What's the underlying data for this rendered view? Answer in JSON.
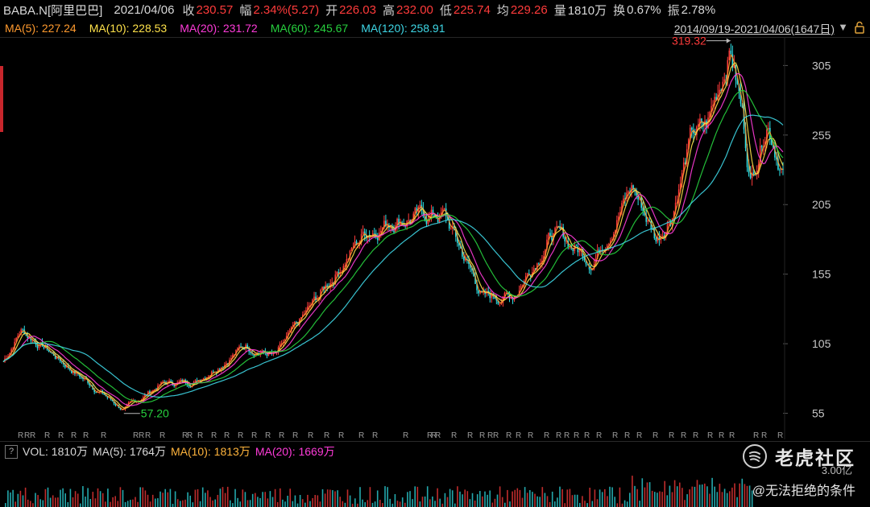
{
  "header": {
    "symbol": "BABA.N[阿里巴巴]",
    "date": "2021/04/06",
    "close_label": "收",
    "close": "230.57",
    "change_label": "幅",
    "change": "2.34%(5.27)",
    "open_label": "开",
    "open": "226.03",
    "high_label": "高",
    "high": "232.00",
    "low_label": "低",
    "low": "225.74",
    "avg_label": "均",
    "avg": "229.26",
    "vol_label": "量",
    "vol": "1810万",
    "turnover_label": "换",
    "turnover": "0.67%",
    "amplitude_label": "振",
    "amplitude": "2.78%"
  },
  "ma_bar": [
    {
      "text": "MA(5): 227.24",
      "color": "#ff9a2e"
    },
    {
      "text": "MA(10): 228.53",
      "color": "#ffe24a"
    },
    {
      "text": "MA(20): 231.72",
      "color": "#ff3bd9"
    },
    {
      "text": "MA(60): 245.67",
      "color": "#27d13e"
    },
    {
      "text": "MA(120): 258.91",
      "color": "#3ed7e6"
    }
  ],
  "range_text": "2014/09/19-2021/04/06(1647日)",
  "vol_bar": {
    "help": "?",
    "items": [
      {
        "text": "VOL: 1810万",
        "color": "#d8d8d8"
      },
      {
        "text": "MA(5): 1764万",
        "color": "#d8d8d8"
      },
      {
        "text": "MA(10): 1813万",
        "color": "#ffb43c"
      },
      {
        "text": "MA(20): 1669万",
        "color": "#ff3bd9"
      }
    ],
    "cap": "3.00亿"
  },
  "watermark": {
    "name": "老虎社区",
    "author": "@无法拒绝的条件"
  },
  "chart_data": {
    "type": "line",
    "description_series": "approximate daily close of BABA, Sep 2014 - Apr 2021",
    "x_range": [
      "2014/09/19",
      "2021/04/06"
    ],
    "ylim": [
      42,
      322
    ],
    "y_ticks": [
      55,
      105,
      155,
      205,
      255,
      305
    ],
    "annotations": [
      {
        "text": "319.32",
        "x": "2020/10/27",
        "y": 319.32,
        "color": "#ff3b3b"
      },
      {
        "text": "57.20",
        "x": "2015/09/24",
        "y": 57.2,
        "color": "#27d13e"
      }
    ],
    "r_marker": "R",
    "series": [
      {
        "x": [
          "2014/09/19",
          "2014/11/12",
          "2015/01/15",
          "2015/05/01",
          "2015/09/24",
          "2016/01/15",
          "2016/05/01",
          "2016/10/01",
          "2017/01/01",
          "2017/06/01",
          "2017/10/01",
          "2018/01/01",
          "2018/06/01",
          "2018/10/01",
          "2019/01/01",
          "2019/05/01",
          "2019/09/01",
          "2020/01/01",
          "2020/03/15",
          "2020/05/01",
          "2020/07/01",
          "2020/08/15",
          "2020/10/27",
          "2020/12/01",
          "2020/12/28",
          "2021/02/16",
          "2021/04/06"
        ],
        "values": [
          92,
          115,
          104,
          84,
          57.2,
          76,
          78,
          104,
          96,
          145,
          185,
          195,
          198,
          138,
          140,
          185,
          165,
          218,
          180,
          200,
          255,
          260,
          319.32,
          272,
          222,
          268,
          230.57
        ]
      }
    ]
  }
}
